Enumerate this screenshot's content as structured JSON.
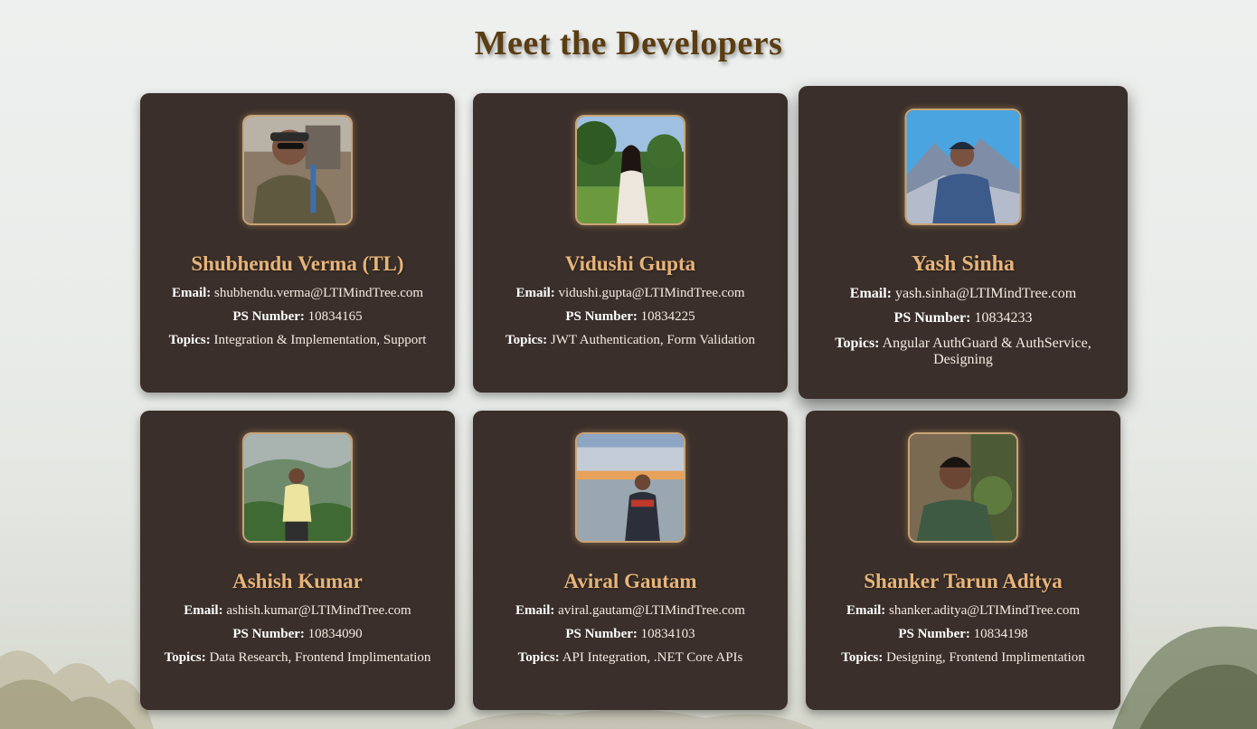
{
  "page": {
    "title": "Meet the Developers"
  },
  "labels": {
    "email": "Email:",
    "ps_number": "PS Number:",
    "topics": "Topics:"
  },
  "developers": [
    {
      "name": "Shubhendu Verma (TL)",
      "email": "shubhendu.verma@LTIMindTree.com",
      "ps_number": "10834165",
      "topics": "Integration & Implementation, Support",
      "photo": "photo-man-sunglasses-lanyard"
    },
    {
      "name": "Vidushi Gupta",
      "email": "vidushi.gupta@LTIMindTree.com",
      "ps_number": "10834225",
      "topics": "JWT Authentication, Form Validation",
      "photo": "photo-woman-garden"
    },
    {
      "name": "Yash Sinha",
      "email": "yash.sinha@LTIMindTree.com",
      "ps_number": "10834233",
      "topics": "Angular AuthGuard & AuthService, Designing",
      "photo": "photo-man-mountains"
    },
    {
      "name": "Ashish Kumar",
      "email": "ashish.kumar@LTIMindTree.com",
      "ps_number": "10834090",
      "topics": "Data Research, Frontend Implimentation",
      "photo": "photo-man-hills"
    },
    {
      "name": "Aviral Gautam",
      "email": "aviral.gautam@LTIMindTree.com",
      "ps_number": "10834103",
      "topics": "API Integration, .NET Core APIs",
      "photo": "photo-man-sunset-city"
    },
    {
      "name": "Shanker Tarun Aditya",
      "email": "shanker.aditya@LTIMindTree.com",
      "ps_number": "10834198",
      "topics": "Designing, Frontend Implimentation",
      "photo": "photo-man-trees"
    }
  ],
  "colors": {
    "card_bg": "#3a2f2a",
    "name_accent": "#e7b47a",
    "title": "#5a3d12"
  }
}
